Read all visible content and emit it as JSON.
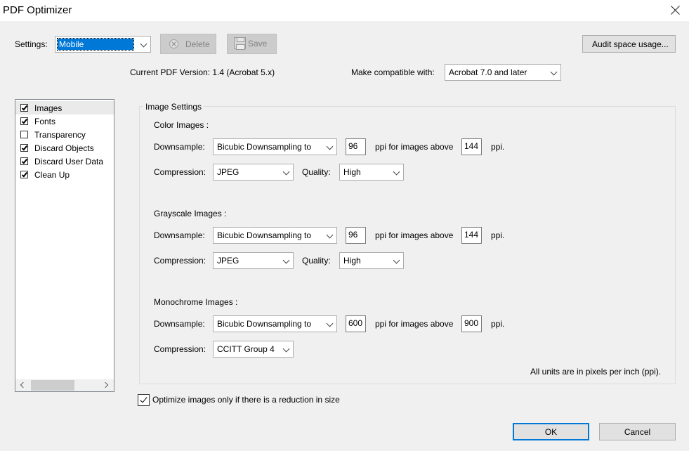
{
  "window": {
    "title": "PDF Optimizer"
  },
  "settings": {
    "label": "Settings:",
    "value": "Mobile",
    "delete_label": "Delete",
    "save_label": "Save",
    "audit_label": "Audit space usage..."
  },
  "version": {
    "current": "Current PDF Version: 1.4 (Acrobat 5.x)",
    "compat_label": "Make compatible with:",
    "compat_value": "Acrobat 7.0 and later"
  },
  "sidebar": {
    "items": [
      {
        "label": "Images",
        "checked": true
      },
      {
        "label": "Fonts",
        "checked": true
      },
      {
        "label": "Transparency",
        "checked": false
      },
      {
        "label": "Discard Objects",
        "checked": true
      },
      {
        "label": "Discard User Data",
        "checked": true
      },
      {
        "label": "Clean Up",
        "checked": true
      }
    ]
  },
  "image_settings": {
    "title": "Image Settings",
    "downsample_label": "Downsample:",
    "compression_label": "Compression:",
    "quality_label": "Quality:",
    "ppi_above_label": "ppi for images above",
    "ppi_label": "ppi.",
    "color": {
      "heading": "Color Images :",
      "downsample": "Bicubic Downsampling to",
      "ppi": "96",
      "above": "144",
      "compression": "JPEG",
      "quality": "High"
    },
    "grayscale": {
      "heading": "Grayscale Images :",
      "downsample": "Bicubic Downsampling to",
      "ppi": "96",
      "above": "144",
      "compression": "JPEG",
      "quality": "High"
    },
    "mono": {
      "heading": "Monochrome Images :",
      "downsample": "Bicubic Downsampling to",
      "ppi": "600",
      "above": "900",
      "compression": "CCITT Group 4"
    },
    "units_note": "All units are in pixels per inch (ppi)."
  },
  "optimize_only": {
    "label": "Optimize images only if there is a reduction in size",
    "checked": true
  },
  "footer": {
    "ok": "OK",
    "cancel": "Cancel"
  }
}
